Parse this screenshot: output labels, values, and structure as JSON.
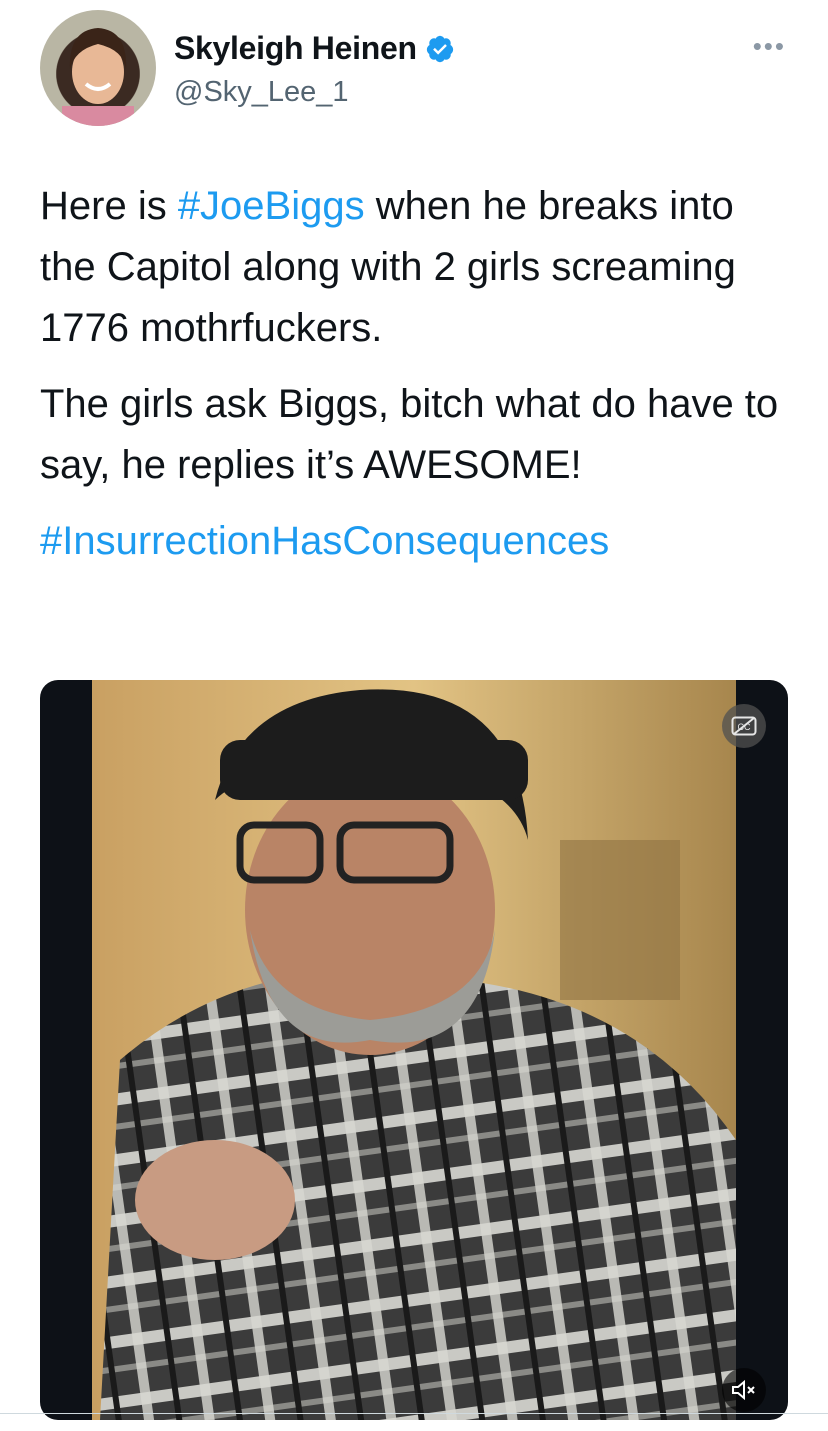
{
  "author": {
    "display_name": "Skyleigh Heinen",
    "handle": "@Sky_Lee_1",
    "verified": true
  },
  "tweet": {
    "paragraph1": {
      "lead": "Here is ",
      "hashtag": "#JoeBiggs",
      "rest": " when he breaks into the Capitol along with 2 girls screaming 1776 mothrfuckers."
    },
    "paragraph2": "The girls ask Biggs, bitch what do have to say, he replies it’s AWESOME!",
    "paragraph3_hashtag": "#InsurrectionHasConsequences"
  },
  "media": {
    "type": "video",
    "controls": {
      "captions_icon": "cc-icon",
      "mute_icon": "speaker-muted-icon"
    }
  },
  "colors": {
    "accent": "#1d9bf0",
    "text": "#0f1419",
    "secondary": "#536471"
  },
  "icons": {
    "verified": "verified-badge-icon",
    "more": "more-options-icon"
  }
}
